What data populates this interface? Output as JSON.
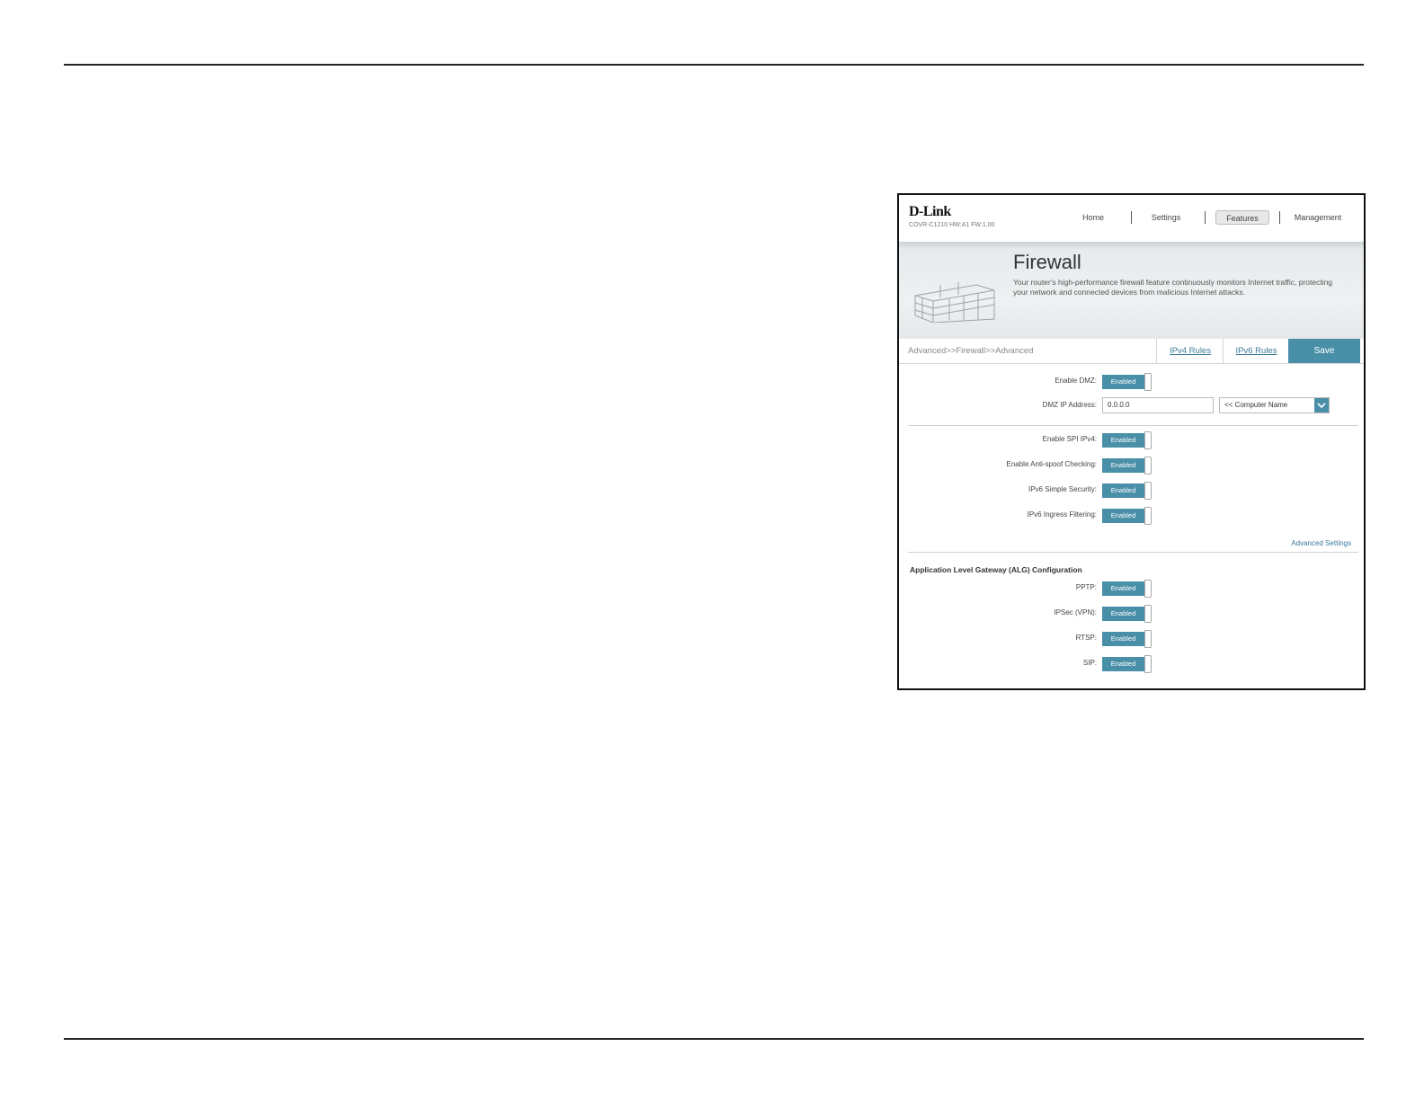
{
  "header": {
    "logo": "D-Link",
    "model": "COVR-C1210 HW:A1 FW:1.00",
    "nav": [
      "Home",
      "Settings",
      "Features",
      "Management"
    ],
    "active_nav": "Features"
  },
  "banner": {
    "title": "Firewall",
    "description": "Your router's high-performance firewall feature continuously monitors Internet traffic, protecting your network and connected devices from malicious Internet attacks."
  },
  "tabs": {
    "breadcrumb": "Advanced>>Firewall>>Advanced",
    "ipv4": "IPv4 Rules",
    "ipv6": "IPv6 Rules",
    "save": "Save"
  },
  "dmz": {
    "enable_label": "Enable DMZ:",
    "enable_value": "Enabled",
    "ip_label": "DMZ IP Address:",
    "ip_value": "0.0.0.0",
    "computer_select": "<< Computer Name"
  },
  "security": {
    "spi_label": "Enable SPI IPv4:",
    "spi_value": "Enabled",
    "antispoof_label": "Enable Anti-spoof Checking:",
    "antispoof_value": "Enabled",
    "ipv6simple_label": "IPv6 Simple Security:",
    "ipv6simple_value": "Enabled",
    "ipv6ingress_label": "IPv6 Ingress Filtering:",
    "ipv6ingress_value": "Enabled",
    "advanced_link": "Advanced Settings"
  },
  "alg": {
    "title": "Application Level Gateway (ALG) Configuration",
    "pptp_label": "PPTP:",
    "pptp_value": "Enabled",
    "ipsec_label": "IPSec (VPN):",
    "ipsec_value": "Enabled",
    "rtsp_label": "RTSP:",
    "rtsp_value": "Enabled",
    "sip_label": "SIP:",
    "sip_value": "Enabled"
  },
  "colors": {
    "accent": "#4a8fa8",
    "link": "#3a7a99"
  }
}
